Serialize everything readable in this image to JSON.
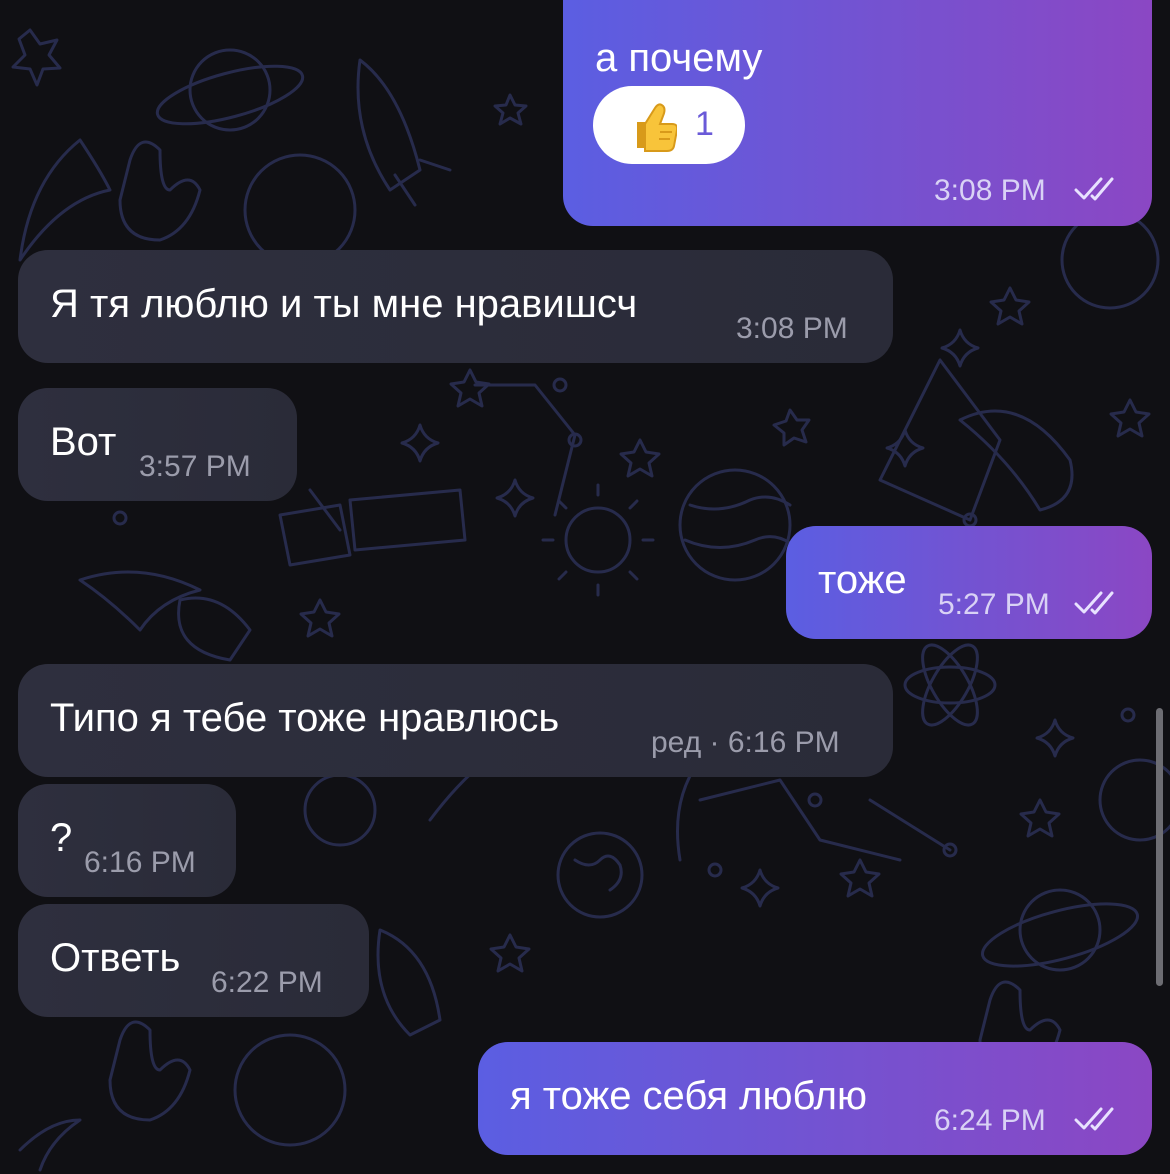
{
  "messages": [
    {
      "id": "m1",
      "direction": "outgoing",
      "text": "а почему",
      "time": "3:08 PM",
      "read": true,
      "reaction": {
        "emoji": "thumbs-up",
        "count": "1"
      }
    },
    {
      "id": "m2",
      "direction": "incoming",
      "text": "Я тя люблю и ты мне нравишсч",
      "time": "3:08 PM"
    },
    {
      "id": "m3",
      "direction": "incoming",
      "text": "Вот",
      "time": "3:57 PM"
    },
    {
      "id": "m4",
      "direction": "outgoing",
      "text": "тоже",
      "time": "5:27 PM",
      "read": true
    },
    {
      "id": "m5",
      "direction": "incoming",
      "text": "Типо я тебе тоже нравлюсь",
      "time": "ред · 6:16 PM"
    },
    {
      "id": "m6",
      "direction": "incoming",
      "text": "?",
      "time": "6:16 PM"
    },
    {
      "id": "m7",
      "direction": "incoming",
      "text": "Ответь",
      "time": "6:22 PM"
    },
    {
      "id": "m8",
      "direction": "outgoing",
      "text": "я тоже себя люблю",
      "time": "6:24 PM",
      "read": true
    }
  ],
  "icons": {
    "read_receipt": "double-check-icon",
    "reaction": "thumbs-up-icon"
  },
  "colors": {
    "background": "#101014",
    "wallpaper_doodle": "#262a4a",
    "incoming_bubble": "#2e2f3e",
    "outgoing_gradient_start": "#5b5ee2",
    "outgoing_gradient_end": "#8b47c4",
    "reaction_count": "#6a5ad8"
  }
}
